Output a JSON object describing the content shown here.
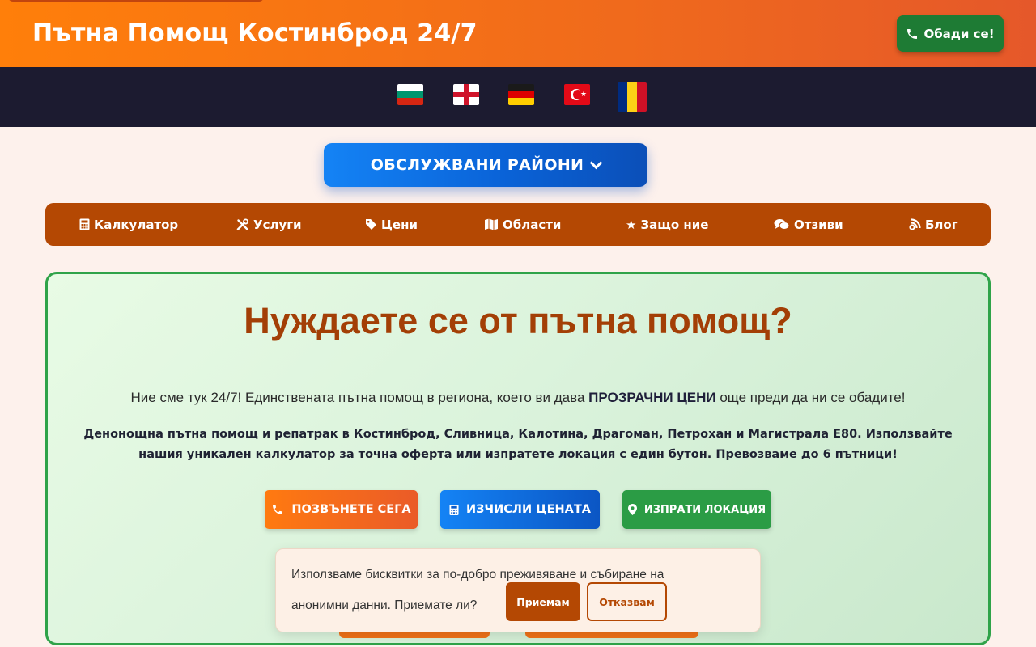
{
  "header": {
    "title": "Пътна Помощ Костинброд 24/7",
    "call_button": "Обади се!",
    "call_icon": "phone-icon"
  },
  "languages": [
    {
      "code": "bg",
      "icon": "flag-bulgaria-icon"
    },
    {
      "code": "en",
      "icon": "flag-england-icon"
    },
    {
      "code": "de",
      "icon": "flag-germany-icon"
    },
    {
      "code": "tr",
      "icon": "flag-turkey-icon"
    },
    {
      "code": "ro",
      "icon": "flag-romania-icon"
    }
  ],
  "regions_button": "ОБСЛУЖВАНИ РАЙОНИ",
  "nav": {
    "items": [
      {
        "label": "Калкулатор",
        "icon": "calculator-icon"
      },
      {
        "label": "Услуги",
        "icon": "tools-icon"
      },
      {
        "label": "Цени",
        "icon": "tag-icon"
      },
      {
        "label": "Области",
        "icon": "map-icon"
      },
      {
        "label": "Защо ние",
        "icon": "star-icon"
      },
      {
        "label": "Отзиви",
        "icon": "comments-icon"
      },
      {
        "label": "Блог",
        "icon": "blog-icon"
      }
    ]
  },
  "hero": {
    "title": "Нуждаете се от пътна помощ?",
    "line1_start": "Ние сме тук 24/7! Единствената пътна помощ в региона, което ви дава ",
    "line1_bold": "ПРОЗРАЧНИ ЦЕНИ",
    "line1_end": " още преди да ни се обадите!",
    "line2": "Денонощна пътна помощ и репатрак в Костинброд, Сливница, Калотина, Драгоман, Петрохан и Магистрала Е80. Използвайте нашия уникален калкулатор за точна оферта или изпратете локация с един бутон. Превозваме до 6 пътници!",
    "buttons": {
      "call": "ПОЗВЪНЕТЕ СЕГА",
      "calculate": "ИЗЧИСЛИ ЦЕНАТА",
      "location": "ИЗПРАТИ ЛОКАЦИЯ"
    }
  },
  "cookie": {
    "text": "Използваме бисквитки за по-добро преживяване и събиране на анонимни данни. Приемате ли?",
    "accept": "Приемам",
    "decline": "Отказвам"
  },
  "colors": {
    "header_orange": "#ff7f0a",
    "nav_brown": "#b44803",
    "call_green": "#1e7b34",
    "regions_blue": "#0a63d8",
    "hero_border": "#2fa349",
    "hero_title": "#a33f06"
  }
}
